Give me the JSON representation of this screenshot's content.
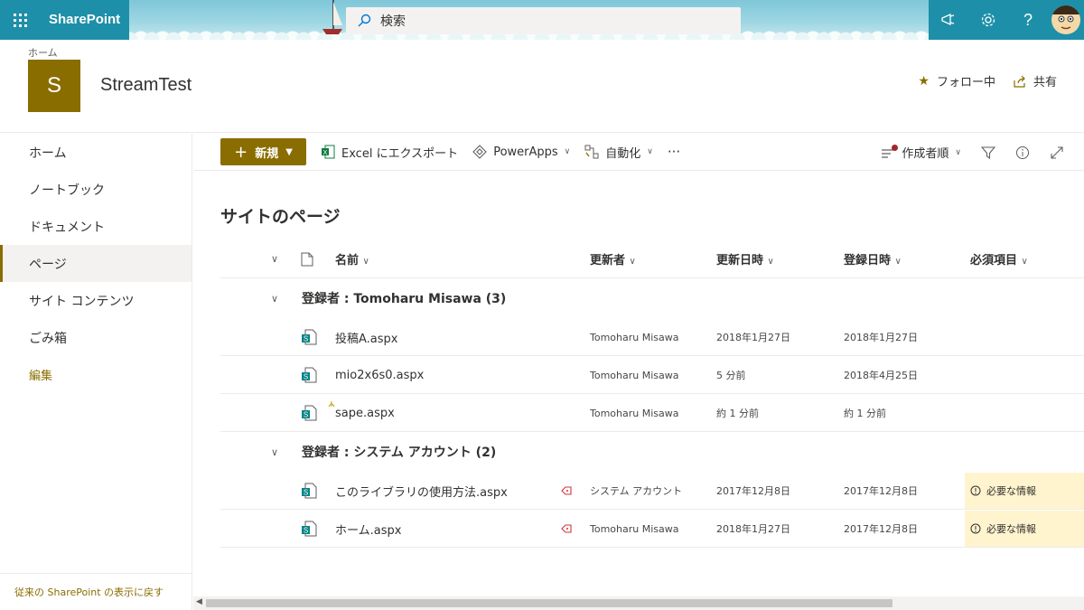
{
  "suite": {
    "brand": "SharePoint",
    "search_placeholder": "検索"
  },
  "header": {
    "breadcrumb": "ホーム",
    "logo_letter": "S",
    "site_title": "StreamTest",
    "follow_label": "フォロー中",
    "share_label": "共有"
  },
  "nav": {
    "items": [
      {
        "label": "ホーム"
      },
      {
        "label": "ノートブック"
      },
      {
        "label": "ドキュメント"
      },
      {
        "label": "ページ",
        "active": true
      },
      {
        "label": "サイト コンテンツ"
      },
      {
        "label": "ごみ箱"
      }
    ],
    "edit_label": "編集",
    "classic_link": "従来の SharePoint の表示に戻す"
  },
  "commandbar": {
    "new_label": "新規",
    "excel_label": "Excel にエクスポート",
    "powerapps_label": "PowerApps",
    "automate_label": "自動化",
    "more_label": "···",
    "sort_label": "作成者順"
  },
  "list": {
    "heading": "サイトのページ",
    "columns": {
      "name": "名前",
      "modified_by": "更新者",
      "modified": "更新日時",
      "created": "登録日時",
      "required": "必須項目"
    },
    "groups": [
      {
        "title": "登録者 : Tomoharu Misawa (3)",
        "rows": [
          {
            "name": "投稿A.aspx",
            "modified_by": "Tomoharu Misawa",
            "modified": "2018年1月27日",
            "created": "2018年1月27日",
            "required": ""
          },
          {
            "name": "mio2x6s0.aspx",
            "modified_by": "Tomoharu Misawa",
            "modified": "5 分前",
            "created": "2018年4月25日",
            "required": ""
          },
          {
            "name": "sape.aspx",
            "modified_by": "Tomoharu Misawa",
            "modified": "約 1 分前",
            "created": "約 1 分前",
            "required": "",
            "is_new": true
          }
        ]
      },
      {
        "title": "登録者 : システム アカウント (2)",
        "rows": [
          {
            "name": "このライブラリの使用方法.aspx",
            "modified_by": "システム アカウント",
            "modified": "2017年12月8日",
            "created": "2017年12月8日",
            "required": "必要な情報",
            "pinned": true
          },
          {
            "name": "ホーム.aspx",
            "modified_by": "Tomoharu Misawa",
            "modified": "2018年1月27日",
            "created": "2017年12月8日",
            "required": "必要な情報",
            "pinned": true
          }
        ]
      }
    ]
  },
  "colors": {
    "accent": "#8a6d00",
    "suite": "#1e8fa8",
    "required_bg": "#fff4ce",
    "pin": "#d13438"
  }
}
